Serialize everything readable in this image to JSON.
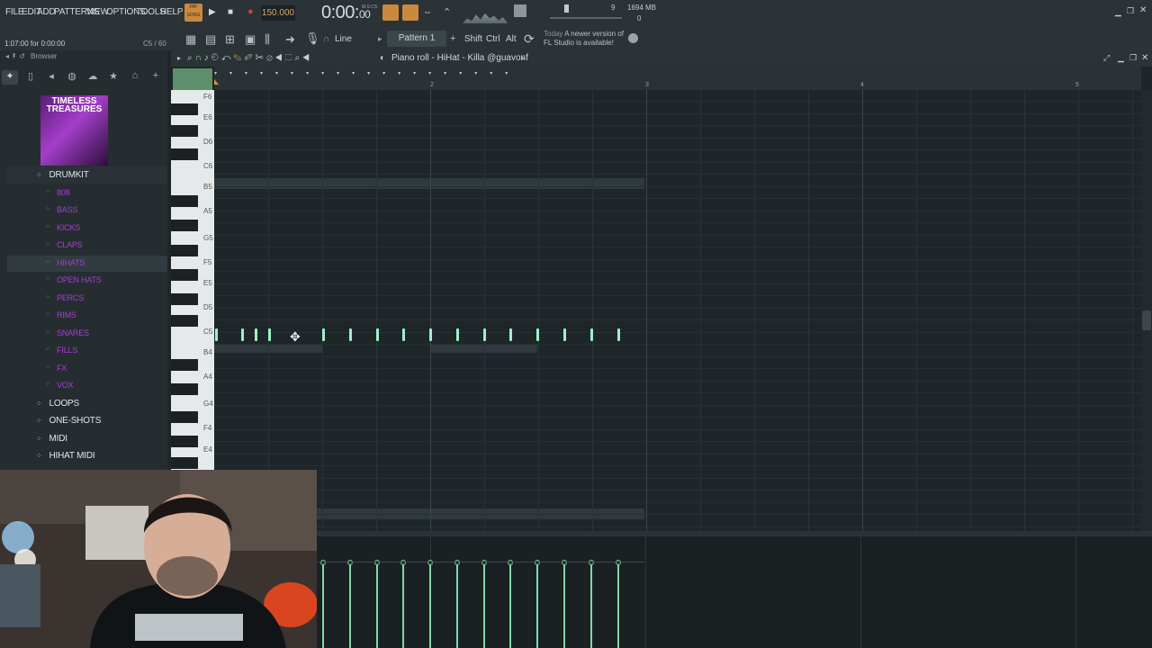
{
  "menu": [
    "FILE",
    "EDIT",
    "ADD",
    "PATTERNS",
    "VIEW",
    "OPTIONS",
    "TOOLS",
    "HELP"
  ],
  "transport": {
    "mode_top": "PAT",
    "mode_bottom": "SONG",
    "bpm": "150.000",
    "time_main": "0:00:",
    "time_small": "00",
    "time_unit": "M:S:CS",
    "memory": "1694 MB",
    "cpu_count": "9",
    "zero": "0"
  },
  "hint": "1:07:00 for 0:00:00",
  "key_readout": "C5 / 60",
  "toolbar": {
    "snap": "Line",
    "pattern": "Pattern 1",
    "shift": "Shift",
    "ctrl": "Ctrl",
    "alt": "Alt",
    "news_label": "Today",
    "news_text1": "A newer version of",
    "news_text2": "FL Studio is available!"
  },
  "browser": {
    "title": "Browser",
    "album_text": "TIMELESS TREASURES",
    "folders": [
      {
        "label": "DRUMKIT"
      },
      {
        "label": "LOOPS"
      },
      {
        "label": "ONE-SHOTS"
      },
      {
        "label": "MIDI"
      },
      {
        "label": "HIHAT MIDI"
      }
    ],
    "subfolders": [
      "808",
      "BASS",
      "KICKS",
      "CLAPS",
      "HIHATS",
      "OPEN HATS",
      "PERCS",
      "RIMS",
      "SNARES",
      "FILLS",
      "FX",
      "VOX"
    ],
    "selected": "HIHATS"
  },
  "piano_roll": {
    "title": "Piano roll - HiHat - Killa @guavonf",
    "ruler": [
      "2",
      "3",
      "4",
      "5"
    ],
    "keys": [
      "F6",
      "E6",
      "D6",
      "C6",
      "B5",
      "A5",
      "G5",
      "F5",
      "E5",
      "D5",
      "C5",
      "B4",
      "A4",
      "G4",
      "F4",
      "E4"
    ],
    "note_row": "C5",
    "note_count": 17,
    "velocity_count": 12
  },
  "colors": {
    "note": "#9ff0c7",
    "accent_orange": "#c98a3d",
    "folder_purple": "#a43fd1",
    "grid_bg": "#1f2629"
  }
}
